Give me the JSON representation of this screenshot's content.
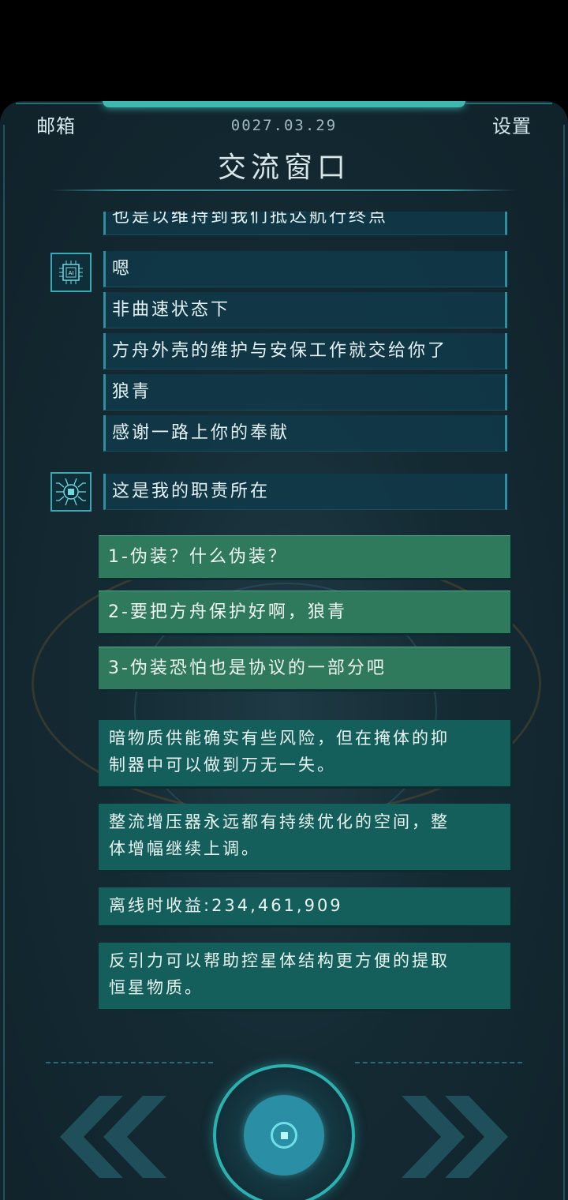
{
  "header": {
    "mail_label": "邮箱",
    "date": "0027.03.29",
    "settings_label": "设置",
    "title": "交流窗口"
  },
  "chat": {
    "partial_message": "也是以维持到我们抵达航行终点",
    "ai_messages": [
      "嗯",
      "非曲速状态下",
      "方舟外壳的维护与安保工作就交给你了",
      "狼青",
      "感谢一路上你的奉献"
    ],
    "robot_message": "这是我的职责所在"
  },
  "options": [
    "1-伪装？什么伪装？",
    "2-要把方舟保护好啊，狼青",
    "3-伪装恐怕也是协议的一部分吧"
  ],
  "info_cards": [
    {
      "lines": [
        "暗物质供能确实有些风险，但在掩体的抑",
        "制器中可以做到万无一失。"
      ]
    },
    {
      "lines": [
        "整流增压器永远都有持续优化的空间，整",
        "体增幅继续上调。"
      ]
    },
    {
      "lines": [
        "离线时收益:234,461,909"
      ]
    },
    {
      "lines": [
        "反引力可以帮助控星体结构更方便的提取",
        "恒星物质。"
      ]
    }
  ],
  "colors": {
    "accent": "#3fb8b0",
    "option_bg": "#2f7a5c",
    "info_bg": "#145f5b",
    "message_bg": "#103a4a"
  },
  "icons": {
    "ai_avatar": "ai-chip-icon",
    "robot_avatar": "robot-chip-icon",
    "prev": "double-chevron-left-icon",
    "next": "double-chevron-right-icon",
    "center": "center-action-icon"
  }
}
